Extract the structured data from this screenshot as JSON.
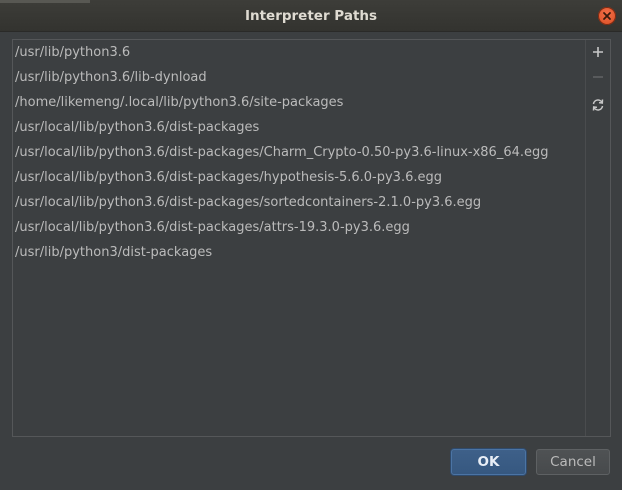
{
  "window": {
    "title": "Interpreter Paths"
  },
  "paths": [
    "/usr/lib/python3.6",
    "/usr/lib/python3.6/lib-dynload",
    "/home/likemeng/.local/lib/python3.6/site-packages",
    "/usr/local/lib/python3.6/dist-packages",
    "/usr/local/lib/python3.6/dist-packages/Charm_Crypto-0.50-py3.6-linux-x86_64.egg",
    "/usr/local/lib/python3.6/dist-packages/hypothesis-5.6.0-py3.6.egg",
    "/usr/local/lib/python3.6/dist-packages/sortedcontainers-2.1.0-py3.6.egg",
    "/usr/local/lib/python3.6/dist-packages/attrs-19.3.0-py3.6.egg",
    "/usr/lib/python3/dist-packages"
  ],
  "toolbar": {
    "add_icon": "plus-icon",
    "remove_icon": "minus-icon",
    "reload_icon": "refresh-icon"
  },
  "footer": {
    "ok_label": "OK",
    "cancel_label": "Cancel"
  },
  "colors": {
    "background": "#3c3f41",
    "text": "#bbbbbb",
    "primary_button": "#365880",
    "close_button": "#e05b2e"
  }
}
